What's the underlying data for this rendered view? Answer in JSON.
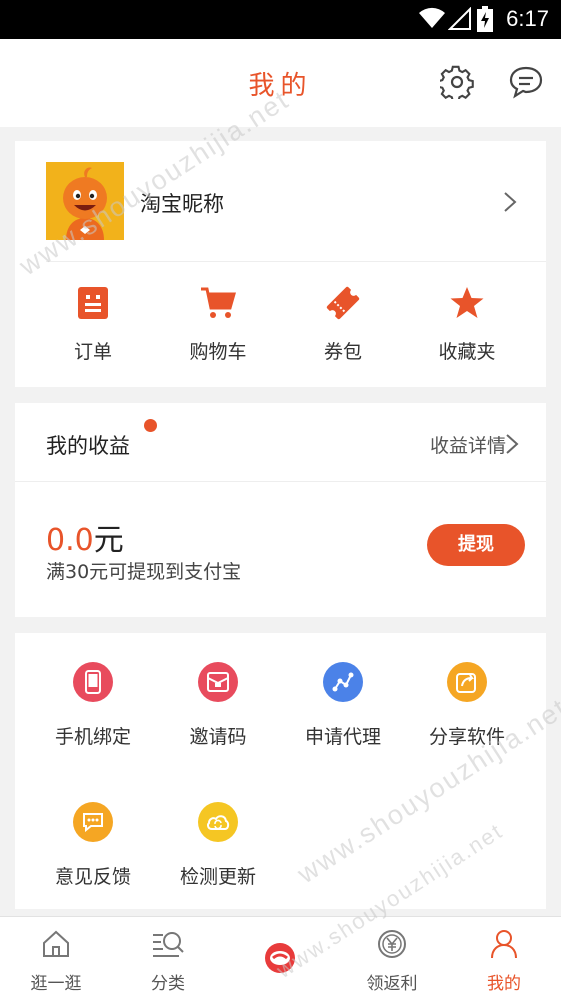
{
  "status_bar": {
    "time": "6:17",
    "icons": [
      "wifi-icon",
      "cell-signal-icon",
      "battery-charging-icon"
    ]
  },
  "header": {
    "title": "我的",
    "icons": [
      "gear-icon",
      "message-icon"
    ]
  },
  "profile": {
    "nickname": "淘宝昵称",
    "quick_links": [
      {
        "label": "订单",
        "icon": "order-icon"
      },
      {
        "label": "购物车",
        "icon": "cart-icon"
      },
      {
        "label": "券包",
        "icon": "coupon-icon"
      },
      {
        "label": "收藏夹",
        "icon": "star-icon"
      }
    ]
  },
  "earnings": {
    "title": "我的收益",
    "detail_link": "收益详情",
    "amount": "0.0",
    "unit": "元",
    "note": "满30元可提现到支付宝",
    "withdraw_button": "提现"
  },
  "tools": [
    {
      "label": "手机绑定",
      "icon": "phone-icon",
      "color": "#e84b5d"
    },
    {
      "label": "邀请码",
      "icon": "envelope-icon",
      "color": "#e84b5d"
    },
    {
      "label": "申请代理",
      "icon": "network-icon",
      "color": "#4b82e8"
    },
    {
      "label": "分享软件",
      "icon": "share-icon",
      "color": "#f5a623"
    },
    {
      "label": "意见反馈",
      "icon": "feedback-icon",
      "color": "#f5a623"
    },
    {
      "label": "检测更新",
      "icon": "refresh-cloud-icon",
      "color": "#f5c623"
    }
  ],
  "tabbar": [
    {
      "label": "逛一逛",
      "icon": "home-icon",
      "active": false
    },
    {
      "label": "分类",
      "icon": "search-list-icon",
      "active": false
    },
    {
      "label": "",
      "icon": "center-logo-icon",
      "active": false
    },
    {
      "label": "领返利",
      "icon": "yen-coin-icon",
      "active": false
    },
    {
      "label": "我的",
      "icon": "user-icon",
      "active": true
    }
  ],
  "watermark": [
    "www.shouyouzhijia.net",
    "www.shouyouzhijia.net",
    "www.shouyouzhijia.net"
  ],
  "colors": {
    "accent": "#e8542a",
    "background": "#f2f2f2"
  }
}
